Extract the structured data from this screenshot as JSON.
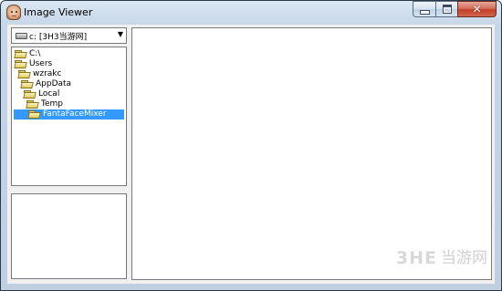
{
  "window": {
    "title": "Image Viewer",
    "buttons": {
      "minimize": "minimize-icon",
      "maximize": "maximize-icon",
      "close": "close-icon"
    }
  },
  "drive_combo": {
    "icon": "drive-icon",
    "value": "c: [3H3当游网]",
    "arrow": "▼"
  },
  "folder_tree": {
    "items": [
      {
        "label": "C:\\"
      },
      {
        "label": "Users"
      },
      {
        "label": "wzrakc"
      },
      {
        "label": "AppData"
      },
      {
        "label": "Local"
      },
      {
        "label": "Temp"
      },
      {
        "label": "FantaFaceMixer",
        "selected": true
      }
    ]
  },
  "watermark": {
    "logo": "3HE",
    "text": "当游网"
  },
  "colors": {
    "selection": "#3399ff",
    "client_background": "#f0f0f0",
    "title_gradient_top": "#dbe7f3"
  }
}
